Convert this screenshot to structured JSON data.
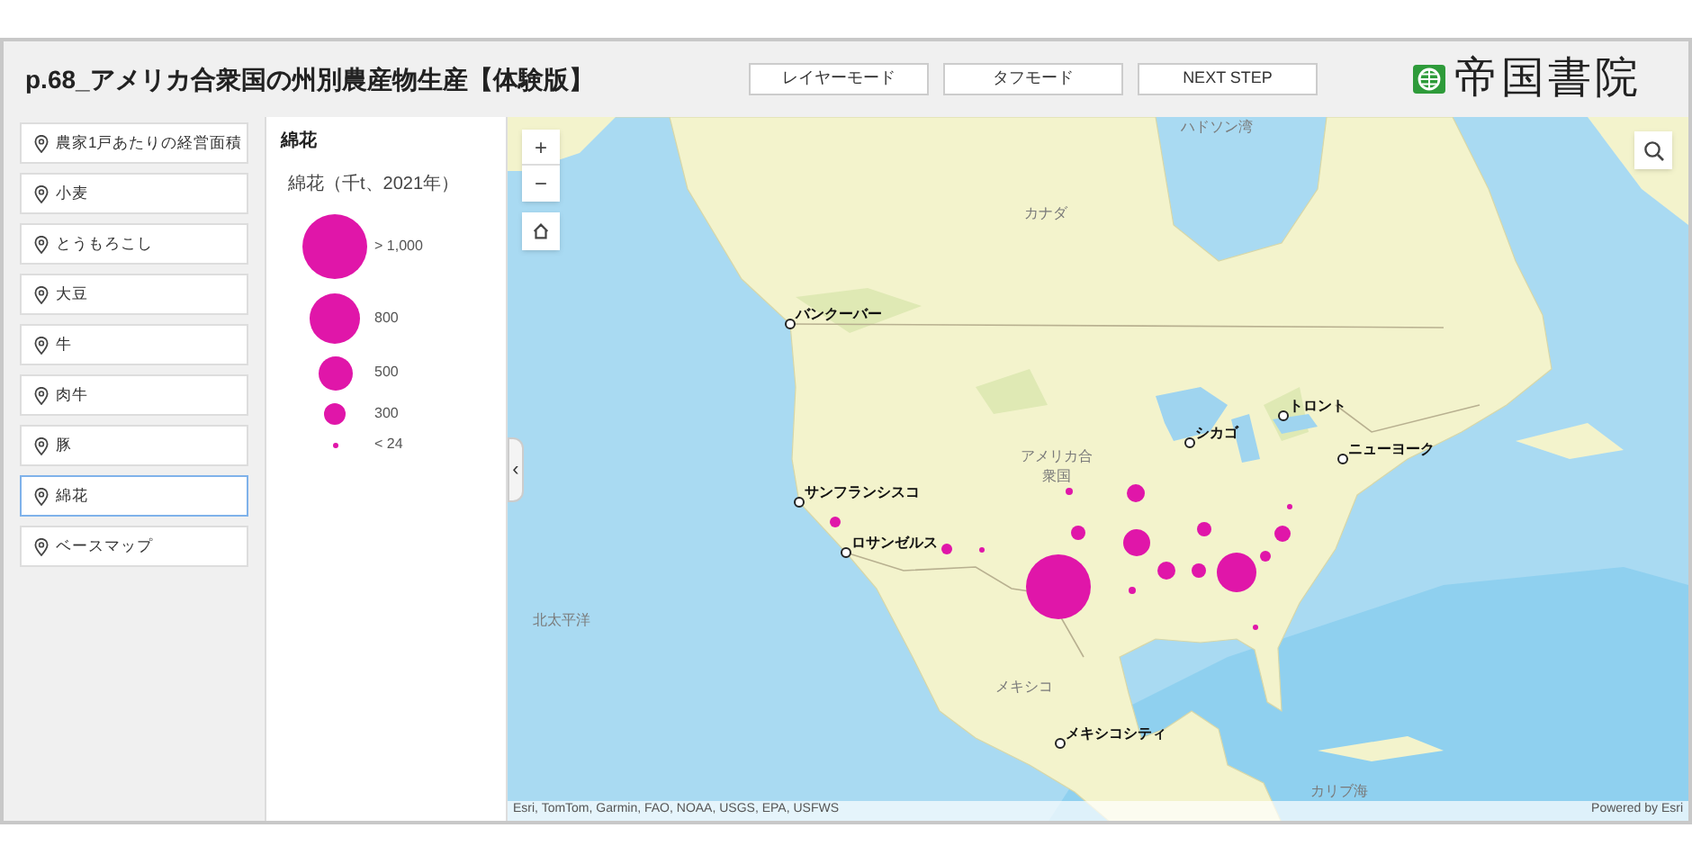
{
  "header": {
    "title": "p.68_アメリカ合衆国の州別農産物生産【体験版】",
    "buttons": [
      {
        "label": "レイヤーモード"
      },
      {
        "label": "タフモード"
      },
      {
        "label": "NEXT STEP"
      }
    ],
    "logo": "帝国書院"
  },
  "sidebar": {
    "items": [
      {
        "label": "農家1戸あたりの経営面積",
        "selected": false
      },
      {
        "label": "小麦",
        "selected": false
      },
      {
        "label": "とうもろこし",
        "selected": false
      },
      {
        "label": "大豆",
        "selected": false
      },
      {
        "label": "牛",
        "selected": false
      },
      {
        "label": "肉牛",
        "selected": false
      },
      {
        "label": "豚",
        "selected": false
      },
      {
        "label": "綿花",
        "selected": true
      },
      {
        "label": "ベースマップ",
        "selected": false
      }
    ]
  },
  "legend": {
    "title": "綿花",
    "subtitle": "綿花（千t、2021年）",
    "items": [
      {
        "label": "> 1,000"
      },
      {
        "label": "800"
      },
      {
        "label": "500"
      },
      {
        "label": "300"
      },
      {
        "label": "< 24"
      }
    ]
  },
  "map": {
    "zoom_in": "+",
    "zoom_out": "−",
    "collapse": "‹",
    "places": [
      {
        "label": "ハドソン湾"
      },
      {
        "label": "カナダ"
      },
      {
        "label": "アメリカ合"
      },
      {
        "label": "衆国"
      },
      {
        "label": "メキシコ"
      },
      {
        "label": "北太平洋"
      },
      {
        "label": "カリブ海"
      }
    ],
    "cities": [
      {
        "label": "バンクーバー"
      },
      {
        "label": "シカゴ"
      },
      {
        "label": "トロント"
      },
      {
        "label": "ニューヨーク"
      },
      {
        "label": "サンフランシスコ"
      },
      {
        "label": "ロサンゼルス"
      },
      {
        "label": "メキシコシティ"
      }
    ],
    "attribution": "Esri, TomTom, Garmin, FAO, NOAA, USGS, EPA, USFWS",
    "powered_by": "Powered by Esri"
  }
}
